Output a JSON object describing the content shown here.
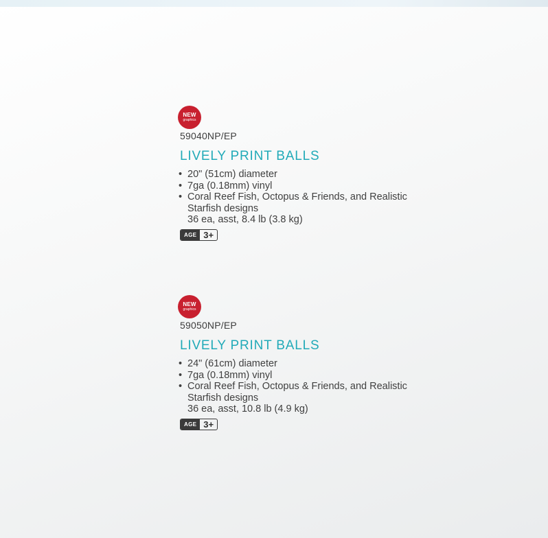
{
  "products": [
    {
      "badge": {
        "new": "NEW",
        "sub": "graphics",
        "color": "#c8202f"
      },
      "sku": "59040NP/EP",
      "title": "LIVELY PRINT BALLS",
      "features": [
        "20\" (51cm) diameter",
        "7ga (0.18mm) vinyl",
        "Coral Reef Fish, Octopus & Friends, and Realistic Starfish designs"
      ],
      "pack": "36 ea, asst, 8.4 lb (3.8 kg)",
      "age": {
        "label": "AGE",
        "value": "3+"
      }
    },
    {
      "badge": {
        "new": "NEW",
        "sub": "graphics",
        "color": "#c8202f"
      },
      "sku": "59050NP/EP",
      "title": "LIVELY PRINT BALLS",
      "features": [
        "24\" (61cm) diameter",
        "7ga (0.18mm) vinyl",
        "Coral Reef Fish, Octopus & Friends, and Realistic Starfish designs"
      ],
      "pack": "36 ea, asst, 10.8 lb (4.9 kg)",
      "age": {
        "label": "AGE",
        "value": "3+"
      }
    }
  ],
  "colors": {
    "title": "#21aab8",
    "text": "#3f3f3f"
  }
}
